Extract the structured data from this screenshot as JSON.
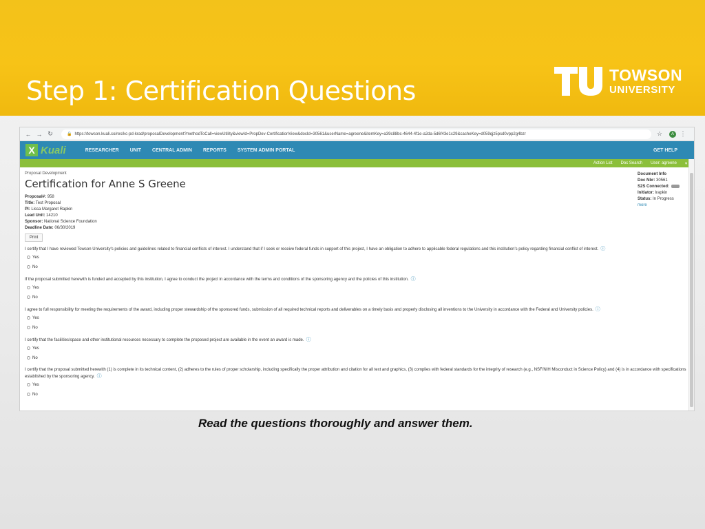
{
  "slide": {
    "title": "Step 1: Certification Questions",
    "logo_line1": "TOWSON",
    "logo_line2": "UNIVERSITY",
    "caption": "Read the questions thoroughly and answer them.",
    "header_color": "#f7c317"
  },
  "browser": {
    "url": "https://towson.kuali.co/res/kc-pd-krad/proposalDevelopment?methodToCall=viewUtility&viewId=PropDev-CertificationView&docId=30561&userName=agreene&itemKey=a39c88bc-4644-4f1e-a2da-5d6f43e1c29&cacheKey=d059qjz5psd0vpp2g4bzr",
    "avatar_letter": "A"
  },
  "kuali": {
    "logo_text": "Kuali",
    "nav": [
      "RESEARCHER",
      "UNIT",
      "CENTRAL ADMIN",
      "REPORTS",
      "SYSTEM ADMIN PORTAL"
    ],
    "help": "GET HELP",
    "sub_nav": [
      "Action List",
      "Doc Search",
      "User: agreene"
    ],
    "accent": "#2e89b4",
    "green": "#8bbf3a"
  },
  "proposal": {
    "breadcrumb": "Proposal Development",
    "title": "Certification for Anne S Greene",
    "fields": [
      {
        "label": "Proposal#:",
        "value": "958"
      },
      {
        "label": "Title:",
        "value": "Test Proposal"
      },
      {
        "label": "PI:",
        "value": "Lissa Margaret Rapkin"
      },
      {
        "label": "Lead Unit:",
        "value": "14210"
      },
      {
        "label": "Sponsor:",
        "value": "National Science Foundation"
      },
      {
        "label": "Deadline Date:",
        "value": "06/30/2019"
      }
    ],
    "print_label": "Print"
  },
  "doc_info": {
    "heading": "Document Info",
    "doc_nbr_label": "Doc Nbr:",
    "doc_nbr": "30561",
    "s2s_label": "S2S Connected:",
    "initiator_label": "Initiator:",
    "initiator": "lrapkin",
    "status_label": "Status:",
    "status": "In Progress",
    "more": "more"
  },
  "questions": [
    {
      "text": "I certify that I have reviewed Towson University's policies and guidelines related to financial conflicts of interest. I understand that if I seek or receive federal funds in support of this project, I have an obligation to adhere to applicable federal regulations and this institution's policy regarding financial conflict of interest.",
      "yes": "Yes",
      "no": "No"
    },
    {
      "text": "If the proposal submitted herewith is funded and accepted by this institution, I agree to conduct the project in accordance with the terms and conditions of the sponsoring agency and the policies of this institution.",
      "yes": "Yes",
      "no": "No"
    },
    {
      "text": "I agree to full responsibility for meeting the requirements of the award, including proper stewardship of the sponsored funds, submission of all required technical reports and deliverables on a timely basis and properly disclosing all inventions to the University in accordance with the Federal and University policies.",
      "yes": "Yes",
      "no": "No"
    },
    {
      "text": "I certify that the facilities/space and other institutional resources necessary to complete the proposed project are available in the event an award is made.",
      "yes": "Yes",
      "no": "No"
    },
    {
      "text": "I certify that the proposal submitted herewith (1) is complete in its technical content, (2) adheres to the rules of proper scholarship, including specifically the proper attribution and citation for all text and graphics, (3) complies with federal standards for the integrity of research (e.g., NSF/NIH Misconduct in Science Policy) and (4) is in accordance with specifications established by the sponsoring agency.",
      "yes": "Yes",
      "no": "No"
    }
  ]
}
